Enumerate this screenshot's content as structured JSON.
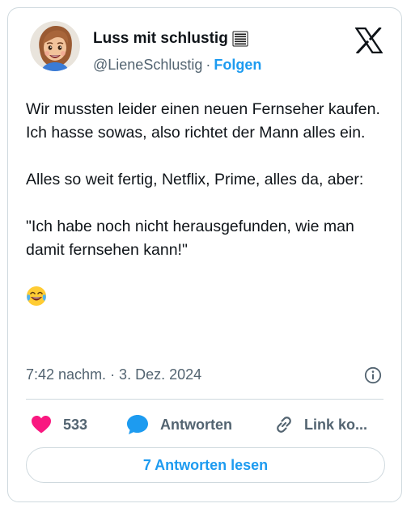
{
  "author": {
    "display_name": "Luss mit schlustig",
    "name_emoji": "ledger-icon",
    "handle": "@LieneSchlustig",
    "separator": "·",
    "follow_label": "Folgen"
  },
  "platform_icon": "x-logo-icon",
  "tweet": {
    "paragraphs": [
      "Wir mussten leider einen neuen Fernseher kaufen. Ich hasse sowas, also richtet der Mann alles ein.",
      "Alles so weit fertig, Netflix, Prime, alles da, aber:",
      "\"Ich habe noch nicht herausgefunden, wie man damit fernsehen kann!\""
    ],
    "trailing_emoji": "face-with-tears-of-joy-icon"
  },
  "meta": {
    "timestamp": "7:42 nachm. · 3. Dez. 2024",
    "info_icon": "info-icon"
  },
  "actions": {
    "like_count": "533",
    "reply_label": "Antworten",
    "copy_link_label": "Link ko..."
  },
  "read_replies_label": "7 Antworten lesen",
  "colors": {
    "accent": "#1d9bf0",
    "like": "#f91880",
    "muted_text": "#536471",
    "border": "#cfd9de",
    "text": "#0f1419"
  }
}
